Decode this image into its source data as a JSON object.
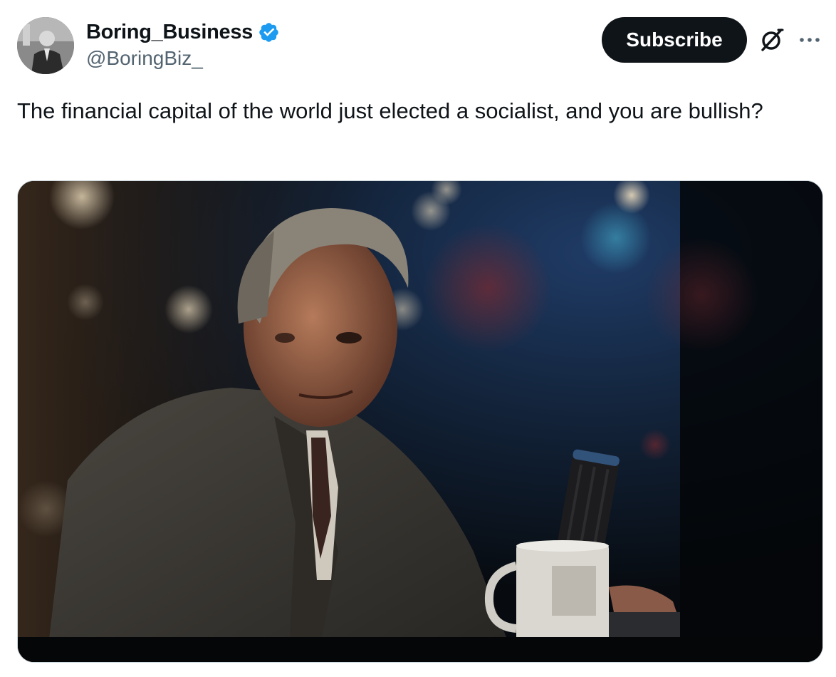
{
  "author": {
    "name": "Boring_Business",
    "handle": "@BoringBiz_",
    "verified": true,
    "verified_color": "#1d9bf0",
    "avatar_icon": "avatar-photo"
  },
  "actions": {
    "subscribe_label": "Subscribe",
    "grok_icon": "grok-icon",
    "more_icon": "more-icon"
  },
  "post": {
    "text": "The financial capital of the world just elected a socialist, and you are bullish?",
    "media_type": "video-still"
  },
  "colors": {
    "text_primary": "#0f1419",
    "text_secondary": "#536471",
    "button_bg": "#0f1419",
    "button_text": "#ffffff",
    "media_border": "#cfd9de"
  }
}
